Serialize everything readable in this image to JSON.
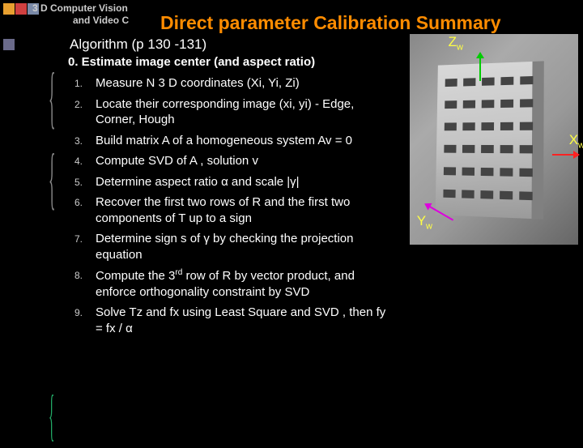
{
  "header": {
    "course": "3 D Computer Vision",
    "subtitle_prefix": "and Video C",
    "main_title": "Direct parameter Calibration Summary"
  },
  "algorithm_ref": "Algorithm (p 130 -131)",
  "step0": "0.   Estimate image center (and aspect ratio)",
  "steps": [
    {
      "n": "1.",
      "text": "Measure N 3 D coordinates (Xi, Yi, Zi)"
    },
    {
      "n": "2.",
      "text": "Locate their corresponding image (xi, yi) - Edge, Corner, Hough"
    },
    {
      "n": "3.",
      "text": "Build matrix A  of a homogeneous system Av = 0"
    },
    {
      "n": "4.",
      "text": "Compute SVD of A , solution v"
    },
    {
      "n": "5.",
      "text": "Determine aspect ratio α and scale |γ|"
    },
    {
      "n": "6.",
      "text": "Recover the first two rows of R and the first two components of T up to a sign"
    },
    {
      "n": "7.",
      "text": "Determine sign s of γ by checking the projection equation"
    },
    {
      "n": "8.",
      "text": "Compute the 3rd row of R by vector product, and enforce orthogonality constraint by SVD"
    },
    {
      "n": "9.",
      "text": "Solve Tz and fx using Least Square and SVD , then fy = fx / α"
    }
  ],
  "axes": {
    "z": "Z",
    "x": "X",
    "y": "Y",
    "sub": "w"
  },
  "colors": {
    "sq1": "#e8a030",
    "sq2": "#d04040",
    "sq3": "#7a8aa8"
  }
}
